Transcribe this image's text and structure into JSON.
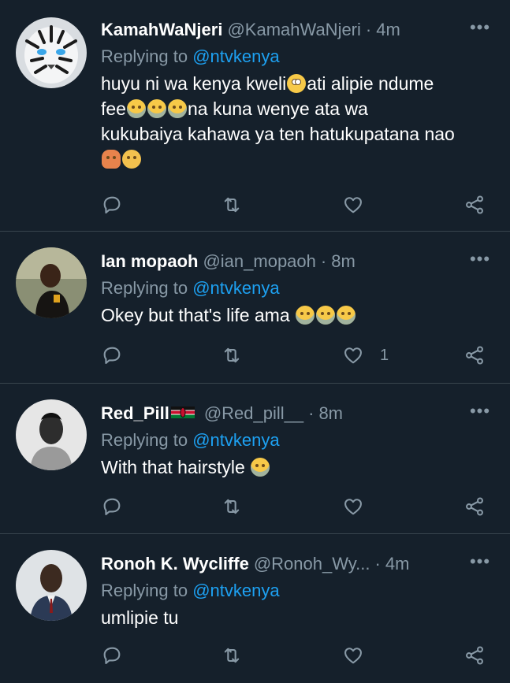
{
  "tweets": [
    {
      "name": "KamahWaNjeri",
      "handle": "@KamahWaNjeri",
      "time": "4m",
      "replying_prefix": "Replying to ",
      "replying_to": "@ntvkenya",
      "text_lines": [
        "huyu ni wa kenya kweli",
        "ati alipie ndume",
        "fee",
        "na kuna wenye ata wa",
        "kukubaiya kahawa ya ten hatukupatana nao"
      ],
      "likes": ""
    },
    {
      "name": "Ian mopaoh",
      "handle": "@ian_mopaoh",
      "time": "8m",
      "replying_prefix": "Replying to ",
      "replying_to": "@ntvkenya",
      "text_lines": [
        "Okey but that's life ama "
      ],
      "likes": "1"
    },
    {
      "name": "Red_Pill",
      "handle": "@Red_pill__",
      "time": "8m",
      "replying_prefix": "Replying to ",
      "replying_to": "@ntvkenya",
      "text_lines": [
        "With that hairstyle "
      ],
      "likes": ""
    },
    {
      "name": "Ronoh K. Wycliffe",
      "handle": "@Ronoh_Wy...",
      "time": "4m",
      "replying_prefix": "Replying to ",
      "replying_to": "@ntvkenya",
      "text_lines": [
        "umlipie tu"
      ],
      "likes": ""
    }
  ],
  "ui": {
    "separator": "·",
    "more": "•••"
  },
  "colors": {
    "background": "#15202b",
    "muted": "#8899a6",
    "accent": "#1da1f2",
    "divider": "#38444d"
  },
  "icons": [
    "reply-icon",
    "retweet-icon",
    "like-icon",
    "share-icon",
    "more-icon"
  ]
}
